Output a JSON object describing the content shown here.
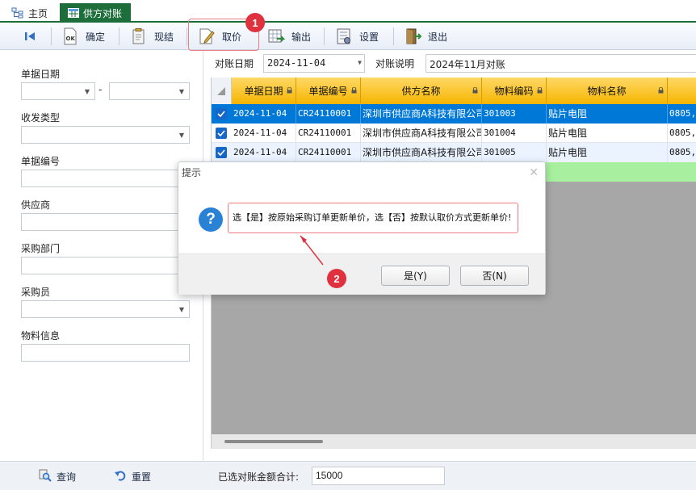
{
  "tabs": {
    "home_label": "主页",
    "active_label": "供方对账"
  },
  "toolbar": {
    "confirm_label": "确定",
    "settle_label": "现结",
    "price_label": "取价",
    "export_label": "输出",
    "settings_label": "设置",
    "exit_label": "退出"
  },
  "markers": {
    "step1": "1",
    "step2": "2"
  },
  "filters": {
    "doc_date_label": "单据日期",
    "date_separator": "-",
    "io_type_label": "收发类型",
    "doc_no_label": "单据编号",
    "supplier_label": "供应商",
    "purchase_dept_label": "采购部门",
    "buyer_label": "采购员",
    "material_info_label": "物料信息"
  },
  "header": {
    "recon_date_label": "对账日期",
    "recon_date_value": "2024-11-04",
    "recon_desc_label": "对账说明",
    "recon_desc_value": "2024年11月对账"
  },
  "grid": {
    "columns": [
      "单据日期",
      "单据编号",
      "供方名称",
      "物料编码",
      "物料名称"
    ],
    "rows": [
      {
        "date": "2024-11-04",
        "doc_no": "CR24110001",
        "supplier": "深圳市供应商A科技有限公司",
        "code": "301003",
        "name": "贴片电阻",
        "spec": "0805,"
      },
      {
        "date": "2024-11-04",
        "doc_no": "CR24110001",
        "supplier": "深圳市供应商A科技有限公司",
        "code": "301004",
        "name": "贴片电阻",
        "spec": "0805,"
      },
      {
        "date": "2024-11-04",
        "doc_no": "CR24110001",
        "supplier": "深圳市供应商A科技有限公司",
        "code": "301005",
        "name": "贴片电阻",
        "spec": "0805,"
      }
    ]
  },
  "bottom": {
    "query_label": "查询",
    "reset_label": "重置",
    "total_label": "已选对账金额合计:",
    "total_value": "15000"
  },
  "dialog": {
    "title": "提示",
    "icon": "?",
    "message": "选【是】按原始采购订单更新单价，选【否】按默认取价方式更新单价!",
    "yes_label": "是(Y)",
    "no_label": "否(N)"
  },
  "colors": {
    "tab_active": "#1e6e3c",
    "header_gold": "#f5b400",
    "row_selected": "#0078d7",
    "marker_red": "#e0323e",
    "new_row_green": "#a8f0a0"
  }
}
